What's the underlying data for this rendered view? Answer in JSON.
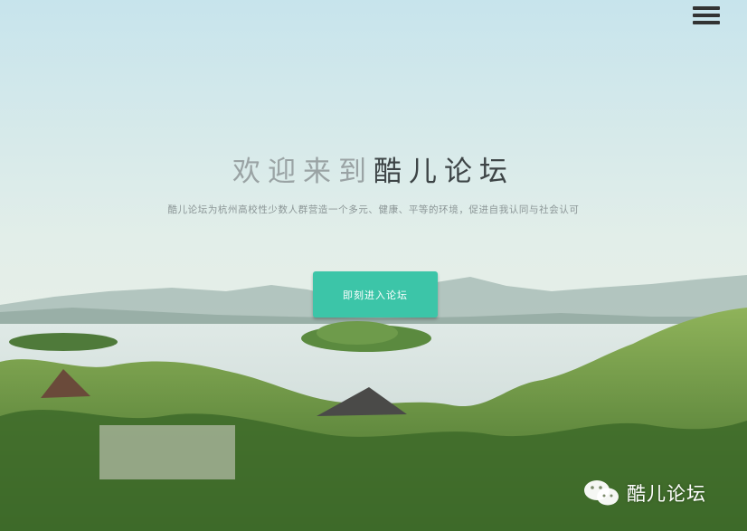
{
  "header": {
    "menu_icon": "hamburger-icon"
  },
  "hero": {
    "title_prefix": "欢迎来到",
    "title_brand": "酷儿论坛",
    "subtitle": "酷儿论坛为杭州高校性少数人群营造一个多元、健康、平等的环境，促进自我认同与社会认可",
    "enter_button_label": "即刻进入论坛",
    "accent_color": "#3cc5a8"
  },
  "watermark": {
    "icon": "wechat-icon",
    "text": "酷儿论坛"
  }
}
